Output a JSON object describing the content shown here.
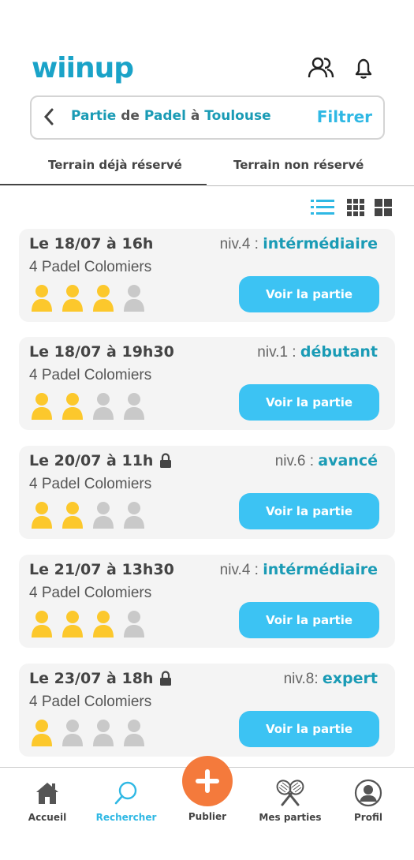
{
  "app": {
    "logo_main": "wiin",
    "logo_tail": "up"
  },
  "search": {
    "prefix": "Partie",
    "sport_word": "de",
    "sport": "Padel",
    "at_word": "à",
    "city": "Toulouse",
    "filter_label": "Filtrer"
  },
  "tabs": [
    {
      "label": "Terrain déjà réservé",
      "active": true
    },
    {
      "label": "Terrain non réservé",
      "active": false
    }
  ],
  "colors": {
    "accent": "#1a9bb5",
    "button": "#3cc3f3",
    "player_filled": "#fcc82c",
    "player_empty": "#c9c9c9",
    "publish": "#f47a3c"
  },
  "games": [
    {
      "date": "Le 18/07 à 16h",
      "locked": false,
      "venue": "4 Padel Colomiers",
      "level_prefix": "niv.4 :",
      "level_name": "intérmédiaire",
      "players_filled": 3,
      "players_total": 4,
      "button_label": "Voir la partie"
    },
    {
      "date": "Le 18/07 à 19h30",
      "locked": false,
      "venue": "4 Padel Colomiers",
      "level_prefix": "niv.1 :",
      "level_name": "débutant",
      "players_filled": 2,
      "players_total": 4,
      "button_label": "Voir la partie"
    },
    {
      "date": "Le 20/07 à 11h",
      "locked": true,
      "venue": "4 Padel Colomiers",
      "level_prefix": "niv.6 :",
      "level_name": "avancé",
      "players_filled": 2,
      "players_total": 4,
      "button_label": "Voir la partie"
    },
    {
      "date": "Le 21/07 à 13h30",
      "locked": false,
      "venue": "4 Padel Colomiers",
      "level_prefix": "niv.4 :",
      "level_name": "intérmédiaire",
      "players_filled": 3,
      "players_total": 4,
      "button_label": "Voir la partie"
    },
    {
      "date": "Le 23/07 à 18h",
      "locked": true,
      "venue": "4 Padel Colomiers",
      "level_prefix": "niv.8:",
      "level_name": "expert",
      "players_filled": 1,
      "players_total": 4,
      "button_label": "Voir la partie"
    }
  ],
  "nav": {
    "home": "Accueil",
    "search": "Rechercher",
    "publish": "Publier",
    "my_games": "Mes parties",
    "profile": "Profil"
  }
}
